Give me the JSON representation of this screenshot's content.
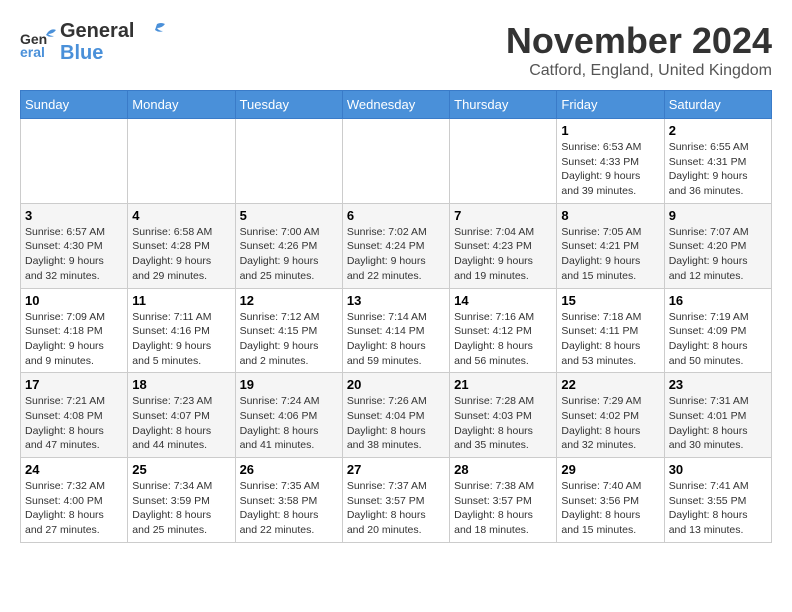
{
  "header": {
    "logo_line1": "General",
    "logo_line2": "Blue",
    "month_title": "November 2024",
    "location": "Catford, England, United Kingdom"
  },
  "days_of_week": [
    "Sunday",
    "Monday",
    "Tuesday",
    "Wednesday",
    "Thursday",
    "Friday",
    "Saturday"
  ],
  "weeks": [
    [
      {
        "day": "",
        "info": ""
      },
      {
        "day": "",
        "info": ""
      },
      {
        "day": "",
        "info": ""
      },
      {
        "day": "",
        "info": ""
      },
      {
        "day": "",
        "info": ""
      },
      {
        "day": "1",
        "info": "Sunrise: 6:53 AM\nSunset: 4:33 PM\nDaylight: 9 hours\nand 39 minutes."
      },
      {
        "day": "2",
        "info": "Sunrise: 6:55 AM\nSunset: 4:31 PM\nDaylight: 9 hours\nand 36 minutes."
      }
    ],
    [
      {
        "day": "3",
        "info": "Sunrise: 6:57 AM\nSunset: 4:30 PM\nDaylight: 9 hours\nand 32 minutes."
      },
      {
        "day": "4",
        "info": "Sunrise: 6:58 AM\nSunset: 4:28 PM\nDaylight: 9 hours\nand 29 minutes."
      },
      {
        "day": "5",
        "info": "Sunrise: 7:00 AM\nSunset: 4:26 PM\nDaylight: 9 hours\nand 25 minutes."
      },
      {
        "day": "6",
        "info": "Sunrise: 7:02 AM\nSunset: 4:24 PM\nDaylight: 9 hours\nand 22 minutes."
      },
      {
        "day": "7",
        "info": "Sunrise: 7:04 AM\nSunset: 4:23 PM\nDaylight: 9 hours\nand 19 minutes."
      },
      {
        "day": "8",
        "info": "Sunrise: 7:05 AM\nSunset: 4:21 PM\nDaylight: 9 hours\nand 15 minutes."
      },
      {
        "day": "9",
        "info": "Sunrise: 7:07 AM\nSunset: 4:20 PM\nDaylight: 9 hours\nand 12 minutes."
      }
    ],
    [
      {
        "day": "10",
        "info": "Sunrise: 7:09 AM\nSunset: 4:18 PM\nDaylight: 9 hours\nand 9 minutes."
      },
      {
        "day": "11",
        "info": "Sunrise: 7:11 AM\nSunset: 4:16 PM\nDaylight: 9 hours\nand 5 minutes."
      },
      {
        "day": "12",
        "info": "Sunrise: 7:12 AM\nSunset: 4:15 PM\nDaylight: 9 hours\nand 2 minutes."
      },
      {
        "day": "13",
        "info": "Sunrise: 7:14 AM\nSunset: 4:14 PM\nDaylight: 8 hours\nand 59 minutes."
      },
      {
        "day": "14",
        "info": "Sunrise: 7:16 AM\nSunset: 4:12 PM\nDaylight: 8 hours\nand 56 minutes."
      },
      {
        "day": "15",
        "info": "Sunrise: 7:18 AM\nSunset: 4:11 PM\nDaylight: 8 hours\nand 53 minutes."
      },
      {
        "day": "16",
        "info": "Sunrise: 7:19 AM\nSunset: 4:09 PM\nDaylight: 8 hours\nand 50 minutes."
      }
    ],
    [
      {
        "day": "17",
        "info": "Sunrise: 7:21 AM\nSunset: 4:08 PM\nDaylight: 8 hours\nand 47 minutes."
      },
      {
        "day": "18",
        "info": "Sunrise: 7:23 AM\nSunset: 4:07 PM\nDaylight: 8 hours\nand 44 minutes."
      },
      {
        "day": "19",
        "info": "Sunrise: 7:24 AM\nSunset: 4:06 PM\nDaylight: 8 hours\nand 41 minutes."
      },
      {
        "day": "20",
        "info": "Sunrise: 7:26 AM\nSunset: 4:04 PM\nDaylight: 8 hours\nand 38 minutes."
      },
      {
        "day": "21",
        "info": "Sunrise: 7:28 AM\nSunset: 4:03 PM\nDaylight: 8 hours\nand 35 minutes."
      },
      {
        "day": "22",
        "info": "Sunrise: 7:29 AM\nSunset: 4:02 PM\nDaylight: 8 hours\nand 32 minutes."
      },
      {
        "day": "23",
        "info": "Sunrise: 7:31 AM\nSunset: 4:01 PM\nDaylight: 8 hours\nand 30 minutes."
      }
    ],
    [
      {
        "day": "24",
        "info": "Sunrise: 7:32 AM\nSunset: 4:00 PM\nDaylight: 8 hours\nand 27 minutes."
      },
      {
        "day": "25",
        "info": "Sunrise: 7:34 AM\nSunset: 3:59 PM\nDaylight: 8 hours\nand 25 minutes."
      },
      {
        "day": "26",
        "info": "Sunrise: 7:35 AM\nSunset: 3:58 PM\nDaylight: 8 hours\nand 22 minutes."
      },
      {
        "day": "27",
        "info": "Sunrise: 7:37 AM\nSunset: 3:57 PM\nDaylight: 8 hours\nand 20 minutes."
      },
      {
        "day": "28",
        "info": "Sunrise: 7:38 AM\nSunset: 3:57 PM\nDaylight: 8 hours\nand 18 minutes."
      },
      {
        "day": "29",
        "info": "Sunrise: 7:40 AM\nSunset: 3:56 PM\nDaylight: 8 hours\nand 15 minutes."
      },
      {
        "day": "30",
        "info": "Sunrise: 7:41 AM\nSunset: 3:55 PM\nDaylight: 8 hours\nand 13 minutes."
      }
    ]
  ]
}
